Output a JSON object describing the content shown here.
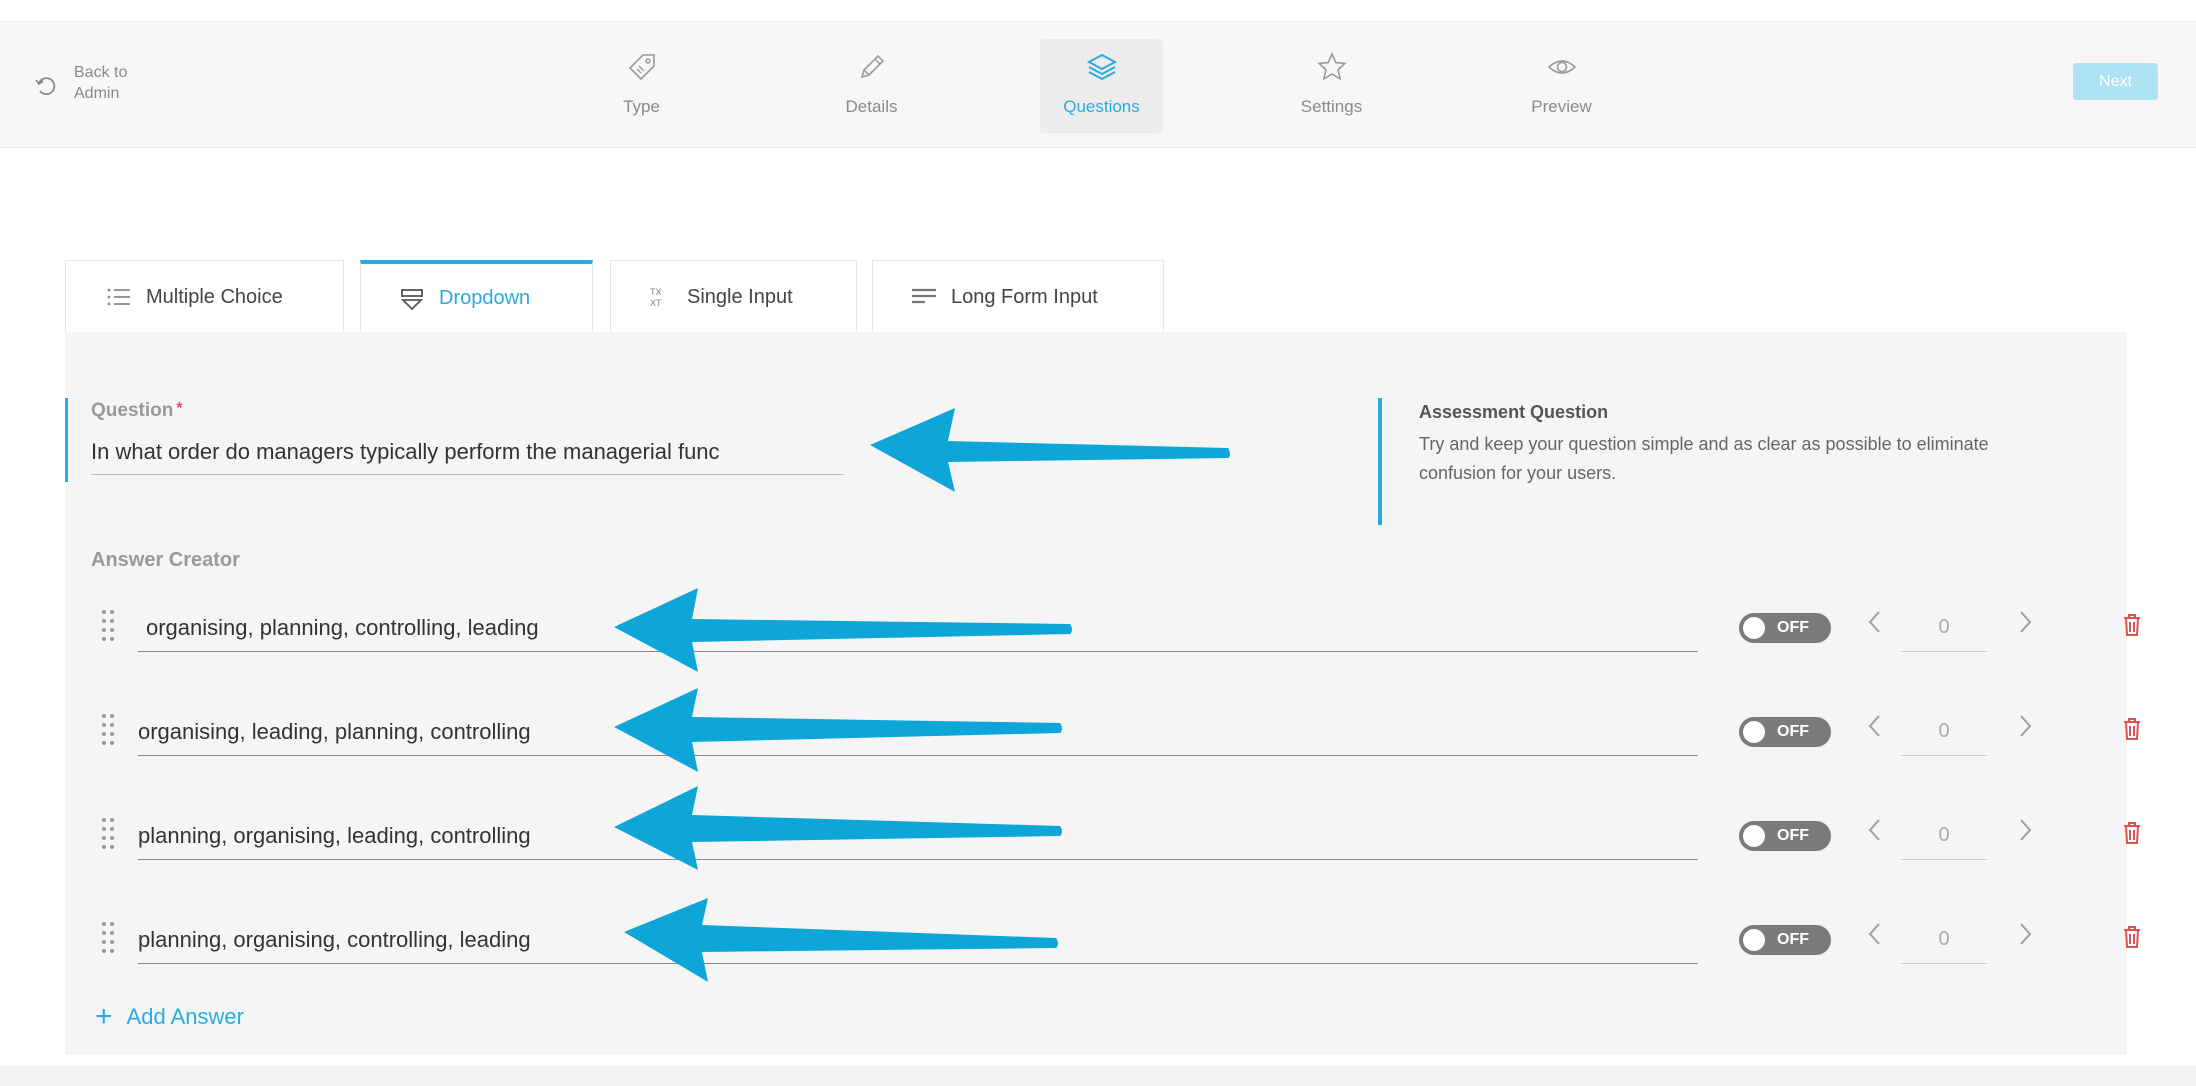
{
  "topbar": {
    "back_label": "Back to Admin",
    "next_label": "Next",
    "steps": [
      {
        "label": "Type",
        "icon": "tag-icon"
      },
      {
        "label": "Details",
        "icon": "pencil-icon"
      },
      {
        "label": "Questions",
        "icon": "layers-icon",
        "active": true
      },
      {
        "label": "Settings",
        "icon": "star-icon"
      },
      {
        "label": "Preview",
        "icon": "eye-icon"
      }
    ]
  },
  "question_types": [
    {
      "label": "Multiple Choice",
      "icon": "list-icon"
    },
    {
      "label": "Dropdown",
      "icon": "dropdown-icon",
      "active": true
    },
    {
      "label": "Single Input",
      "icon": "text-icon"
    },
    {
      "label": "Long Form Input",
      "icon": "paragraph-icon"
    }
  ],
  "question": {
    "label": "Question",
    "required_mark": "*",
    "value": "In what order do managers typically perform the managerial func"
  },
  "info": {
    "title": "Assessment Question",
    "text": "Try and keep your question simple and as clear as possible to eliminate confusion for your users."
  },
  "answer_creator": {
    "label": "Answer Creator",
    "answers": [
      {
        "text": "organising, planning, controlling, leading",
        "toggle": "OFF",
        "score": "0"
      },
      {
        "text": "organising, leading, planning, controlling",
        "toggle": "OFF",
        "score": "0"
      },
      {
        "text": "planning, organising, leading, controlling",
        "toggle": "OFF",
        "score": "0"
      },
      {
        "text": "planning, organising, controlling, leading",
        "toggle": "OFF",
        "score": "0"
      }
    ],
    "add_label": "Add Answer"
  },
  "colors": {
    "accent": "#29abe2",
    "arrow": "#0ea6d8",
    "delete": "#e05050"
  }
}
